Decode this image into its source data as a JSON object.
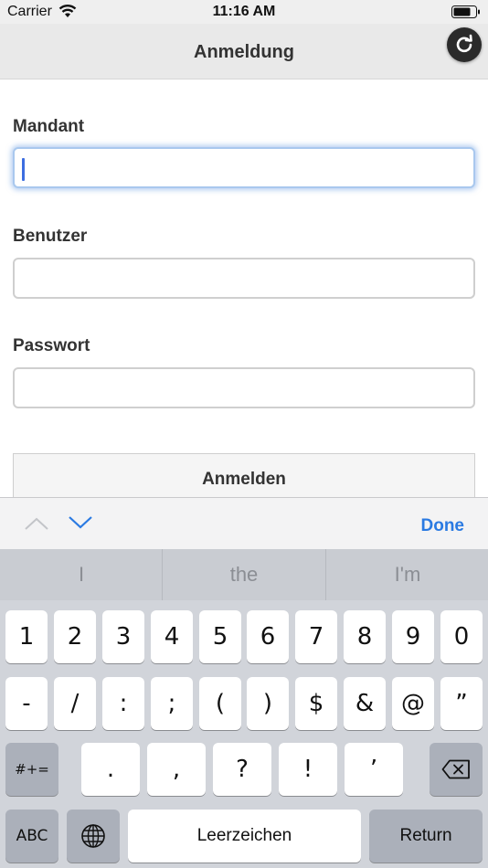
{
  "status": {
    "carrier": "Carrier",
    "time": "11:16 AM"
  },
  "nav": {
    "title": "Anmeldung"
  },
  "form": {
    "fields": [
      {
        "label": "Mandant",
        "value": "",
        "placeholder": ""
      },
      {
        "label": "Benutzer",
        "value": "",
        "placeholder": ""
      },
      {
        "label": "Passwort",
        "value": "",
        "placeholder": ""
      }
    ],
    "submit_label": "Anmelden"
  },
  "accessory": {
    "done_label": "Done"
  },
  "keyboard": {
    "suggestions": [
      "I",
      "the",
      "I'm"
    ],
    "row1": [
      "1",
      "2",
      "3",
      "4",
      "5",
      "6",
      "7",
      "8",
      "9",
      "0"
    ],
    "row2": [
      "-",
      "/",
      ":",
      ";",
      "(",
      ")",
      "$",
      "&",
      "@",
      "”"
    ],
    "row3": {
      "shift": "#+=",
      "keys": [
        ".",
        ",",
        "?",
        "!",
        "’"
      ]
    },
    "row4": {
      "abc": "ABC",
      "space": "Leerzeichen",
      "return": "Return"
    }
  },
  "icons": {
    "refresh": "refresh-icon",
    "wifi": "wifi-icon",
    "battery": "battery-icon",
    "chevron_up": "chevron-up-icon",
    "chevron_down": "chevron-down-icon",
    "globe": "globe-icon",
    "backspace": "backspace-icon"
  },
  "colors": {
    "accent": "#2a7ae2",
    "caret": "#3d6ee0"
  }
}
